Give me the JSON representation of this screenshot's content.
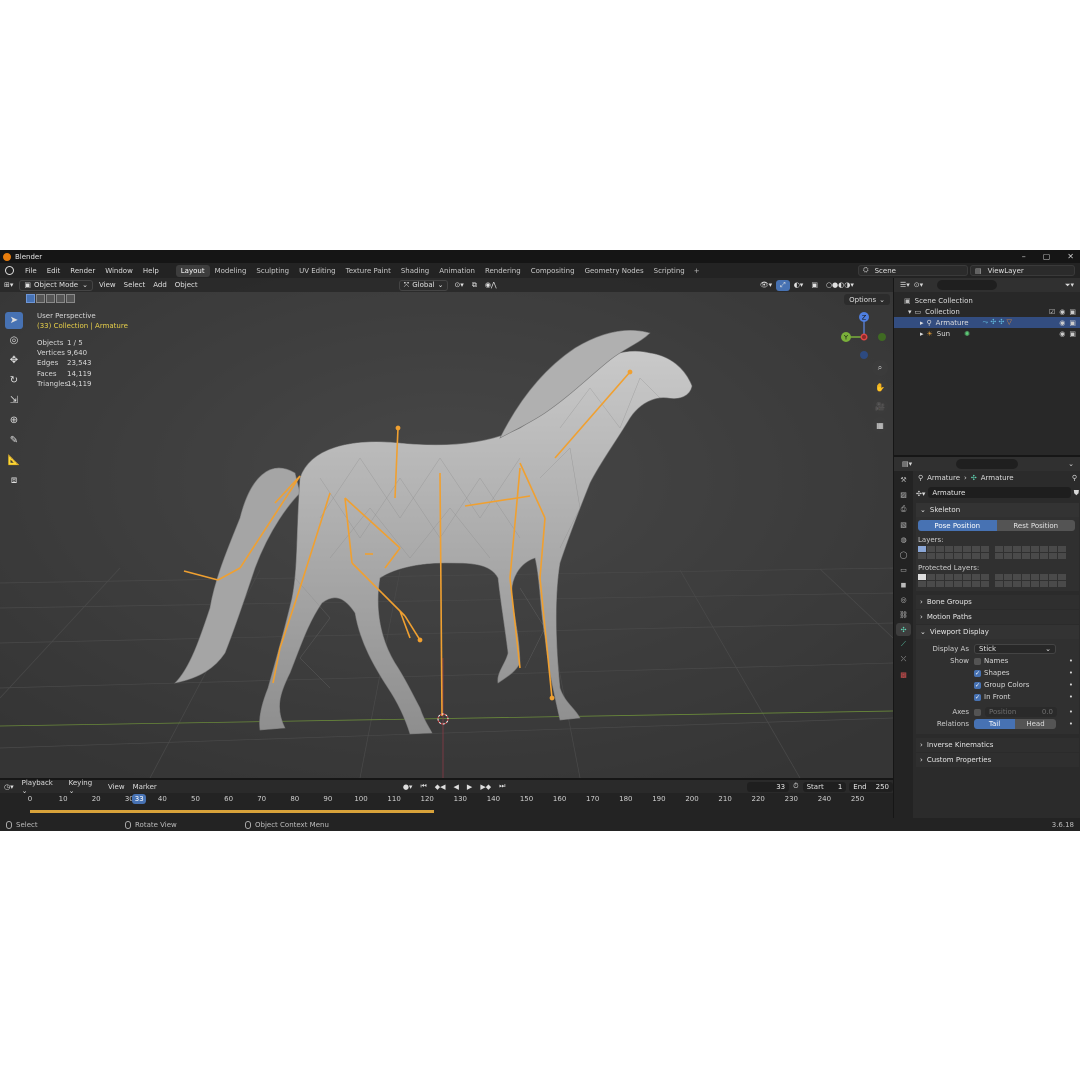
{
  "app": {
    "title": "Blender",
    "version": "3.6.18"
  },
  "menu": [
    "File",
    "Edit",
    "Render",
    "Window",
    "Help"
  ],
  "workspaces": [
    {
      "label": "Layout",
      "active": true
    },
    {
      "label": "Modeling"
    },
    {
      "label": "Sculpting"
    },
    {
      "label": "UV Editing"
    },
    {
      "label": "Texture Paint"
    },
    {
      "label": "Shading"
    },
    {
      "label": "Animation"
    },
    {
      "label": "Rendering"
    },
    {
      "label": "Compositing"
    },
    {
      "label": "Geometry Nodes"
    },
    {
      "label": "Scripting"
    }
  ],
  "scene": {
    "name": "Scene",
    "view_layer": "ViewLayer"
  },
  "viewport": {
    "mode": "Object Mode",
    "menus": [
      "View",
      "Select",
      "Add",
      "Object"
    ],
    "transform_orientation": "Global",
    "options_label": "Options",
    "perspective": "User Perspective",
    "context": "(33) Collection | Armature",
    "stats": [
      {
        "label": "Objects",
        "value": "1 / 5"
      },
      {
        "label": "Vertices",
        "value": "9,640"
      },
      {
        "label": "Edges",
        "value": "23,543"
      },
      {
        "label": "Faces",
        "value": "14,119"
      },
      {
        "label": "Triangles",
        "value": "14,119"
      }
    ],
    "gizmo": {
      "z": "Z",
      "y": "Y"
    }
  },
  "outliner": {
    "rows": [
      {
        "label": "Scene Collection"
      },
      {
        "label": "Collection"
      },
      {
        "label": "Armature",
        "selected": true
      },
      {
        "label": "Sun"
      }
    ]
  },
  "properties": {
    "breadcrumb": [
      "Armature",
      "Armature"
    ],
    "data_name": "Armature",
    "skeleton": {
      "title": "Skeleton",
      "pose_position": "Pose Position",
      "rest_position": "Rest Position",
      "layers_label": "Layers:",
      "protected_layers_label": "Protected Layers:"
    },
    "collapsed_panels_top": [
      "Bone Groups",
      "Motion Paths"
    ],
    "viewport_display": {
      "title": "Viewport Display",
      "display_as_label": "Display As",
      "display_as_value": "Stick",
      "show_label": "Show",
      "names": "Names",
      "shapes": "Shapes",
      "group_colors": "Group Colors",
      "in_front": "In Front",
      "axes_label": "Axes",
      "position_label": "Position",
      "position_value": "0.0",
      "relations_label": "Relations",
      "tail": "Tail",
      "head": "Head"
    },
    "collapsed_panels_bottom": [
      "Inverse Kinematics",
      "Custom Properties"
    ]
  },
  "timeline": {
    "menus": [
      "Playback",
      "Keying",
      "View",
      "Marker"
    ],
    "current_frame": "33",
    "start_label": "Start",
    "start_value": "1",
    "end_label": "End",
    "end_value": "250",
    "ticks": [
      "0",
      "10",
      "20",
      "30",
      "40",
      "50",
      "60",
      "70",
      "80",
      "90",
      "100",
      "110",
      "120",
      "130",
      "140",
      "150",
      "160",
      "170",
      "180",
      "190",
      "200",
      "210",
      "220",
      "230",
      "240",
      "250"
    ]
  },
  "statusbar": {
    "select": "Select",
    "rotate": "Rotate View",
    "context_menu": "Object Context Menu"
  },
  "colors": {
    "accent": "#4772b3",
    "bone": "#f0a030",
    "header_yellow": "#e9d14a",
    "viewport_bg": "#3d3d3d"
  }
}
